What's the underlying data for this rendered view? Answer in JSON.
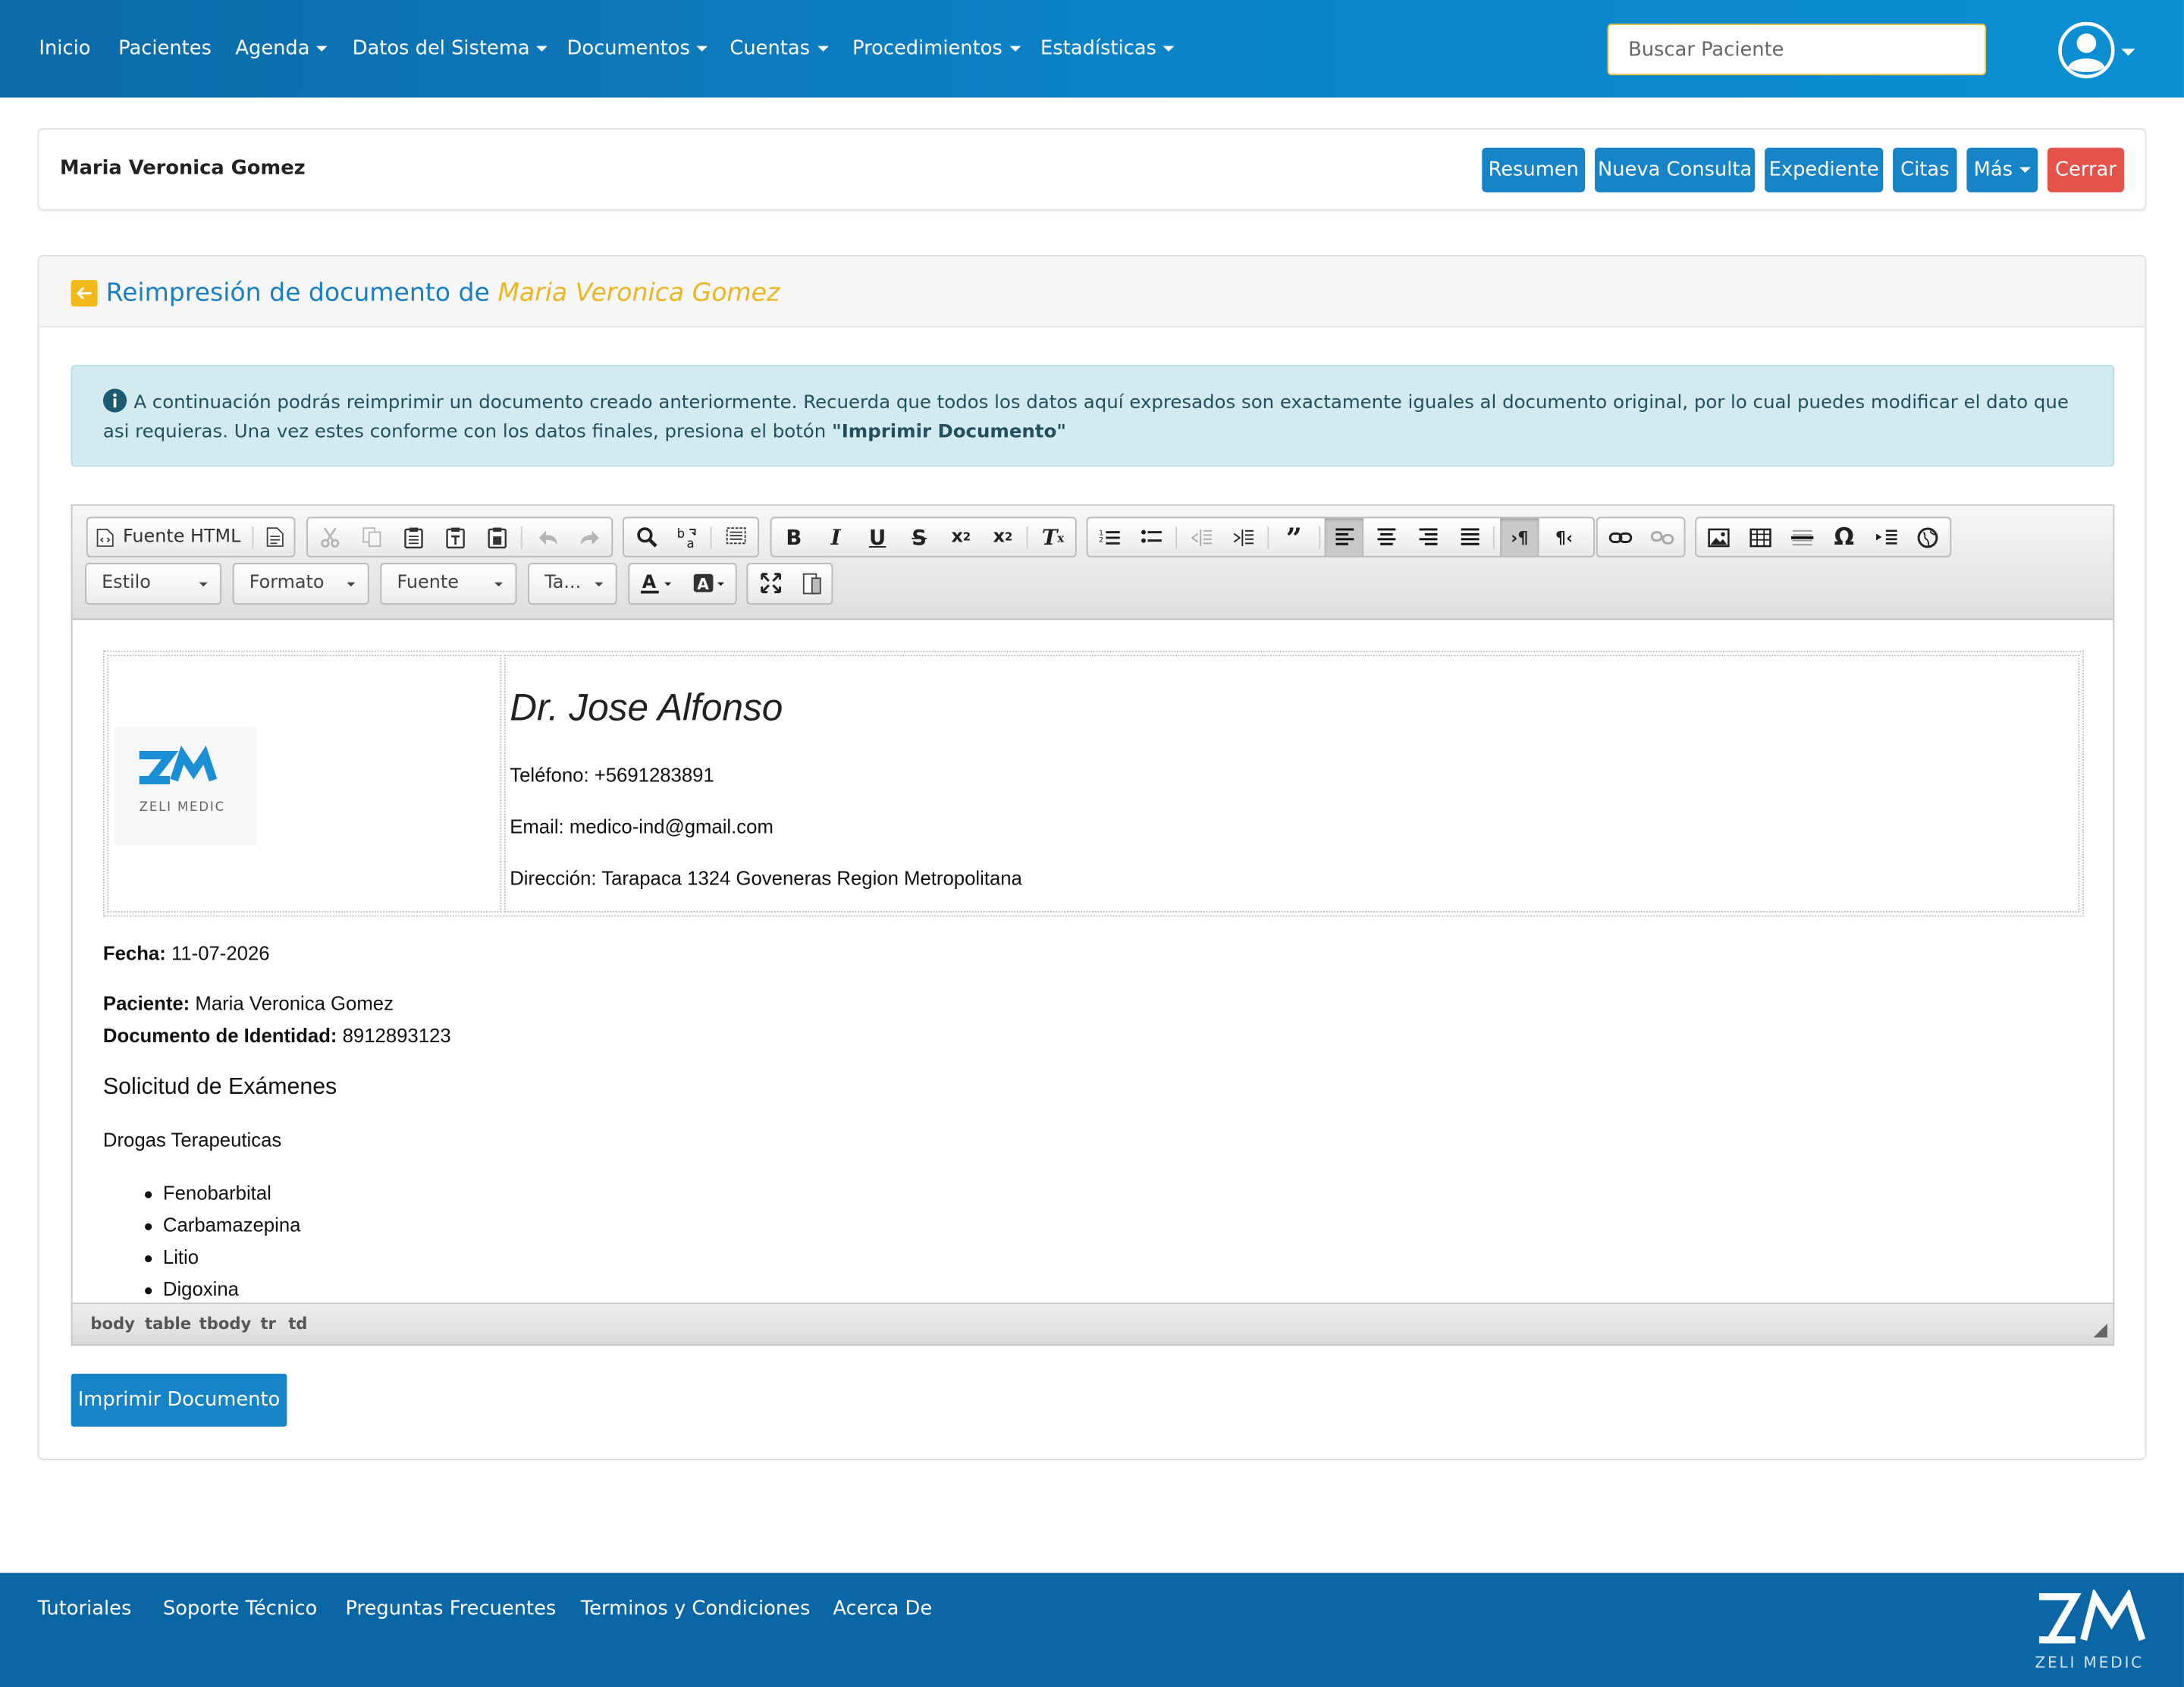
{
  "navbar": {
    "items": [
      {
        "label": "Inicio"
      },
      {
        "label": "Pacientes"
      },
      {
        "label": "Agenda"
      },
      {
        "label": "Datos del Sistema"
      },
      {
        "label": "Documentos"
      },
      {
        "label": "Cuentas"
      },
      {
        "label": "Procedimientos"
      },
      {
        "label": "Estadísticas"
      }
    ],
    "search_placeholder": "Buscar Paciente",
    "user_icon": "user-circle-icon"
  },
  "patient_bar": {
    "name": "Maria Veronica Gomez",
    "buttons": {
      "resumen": "Resumen",
      "nueva_consulta": "Nueva Consulta",
      "expediente": "Expediente",
      "citas": "Citas",
      "mas": "Más",
      "cerrar": "Cerrar"
    }
  },
  "panel": {
    "title_prefix": "Reimpresión de documento de",
    "title_patient": "Maria Veronica Gomez",
    "alert_text": "A continuación podrás reimprimir un documento creado anteriormente. Recuerda que todos los datos aquí expresados son exactamente iguales al documento original, por lo cual puedes modificar el dato que asi requieras. Una vez estes conforme con los datos finales, presiona el botón",
    "alert_emphasis": "\"Imprimir Documento\"",
    "print_button": "Imprimir Documento"
  },
  "editor": {
    "source_button": "Fuente HTML",
    "combos": {
      "style": "Estilo",
      "format": "Formato",
      "font": "Fuente",
      "size": "Ta..."
    },
    "path": [
      "body",
      "table",
      "tbody",
      "tr",
      "td"
    ]
  },
  "document": {
    "logo_text": "ZELI MEDIC",
    "doctor": "Dr. Jose Alfonso",
    "phone": "Teléfono: +5691283891",
    "email": "Email: medico-ind@gmail.com",
    "address": "Dirección: Tarapaca 1324 Goveneras Region Metropolitana",
    "date_label": "Fecha:",
    "date_value": "11-07-2026",
    "patient_label": "Paciente:",
    "patient_value": "Maria Veronica Gomez",
    "id_label": "Documento de Identidad:",
    "id_value": "8912893123",
    "heading": "Solicitud de Exámenes",
    "category": "Drogas Terapeuticas",
    "items": [
      "Fenobarbital",
      "Carbamazepina",
      "Litio",
      "Digoxina"
    ]
  },
  "footer": {
    "links": [
      {
        "label": "Tutoriales"
      },
      {
        "label": "Soporte Técnico"
      },
      {
        "label": "Preguntas Frecuentes"
      },
      {
        "label": "Terminos y Condiciones"
      },
      {
        "label": "Acerca De"
      }
    ],
    "brand": "ZELI MEDIC"
  },
  "colors": {
    "primary": "#1784c7",
    "danger": "#e55249",
    "accent_yellow": "#eab623",
    "alert_bg": "#d3ebf0",
    "footer_bg": "#0a66a4"
  }
}
